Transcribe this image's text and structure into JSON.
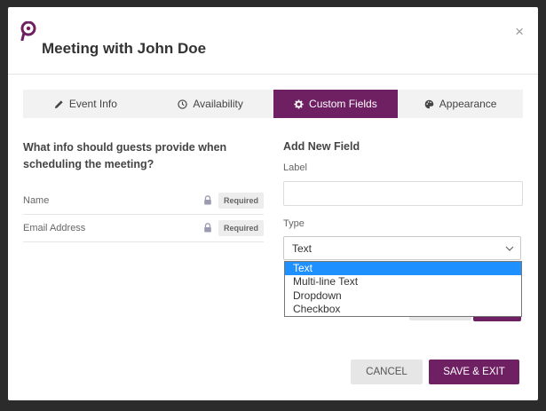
{
  "dialog": {
    "title": "Meeting with John Doe",
    "close_label": "×",
    "brand_color": "#6e2063"
  },
  "tabs": [
    {
      "label": "Event Info",
      "icon": "pencil-icon",
      "active": false
    },
    {
      "label": "Availability",
      "icon": "clock-icon",
      "active": false
    },
    {
      "label": "Custom Fields",
      "icon": "gear-icon",
      "active": true
    },
    {
      "label": "Appearance",
      "icon": "palette-icon",
      "active": false
    }
  ],
  "guest_info": {
    "question": "What info should guests provide when scheduling the meeting?",
    "fields": [
      {
        "name": "Name",
        "badge": "Required",
        "icon": "lock-icon"
      },
      {
        "name": "Email Address",
        "badge": "Required",
        "icon": "lock-icon"
      }
    ]
  },
  "add_field": {
    "title": "Add New Field",
    "label_caption": "Label",
    "label_value": "",
    "type_caption": "Type",
    "type_value": "Text",
    "type_options": [
      "Text",
      "Multi-line Text",
      "Dropdown",
      "Checkbox"
    ]
  },
  "footer": {
    "cancel_label": "CANCEL",
    "save_label": "SAVE & EXIT"
  }
}
